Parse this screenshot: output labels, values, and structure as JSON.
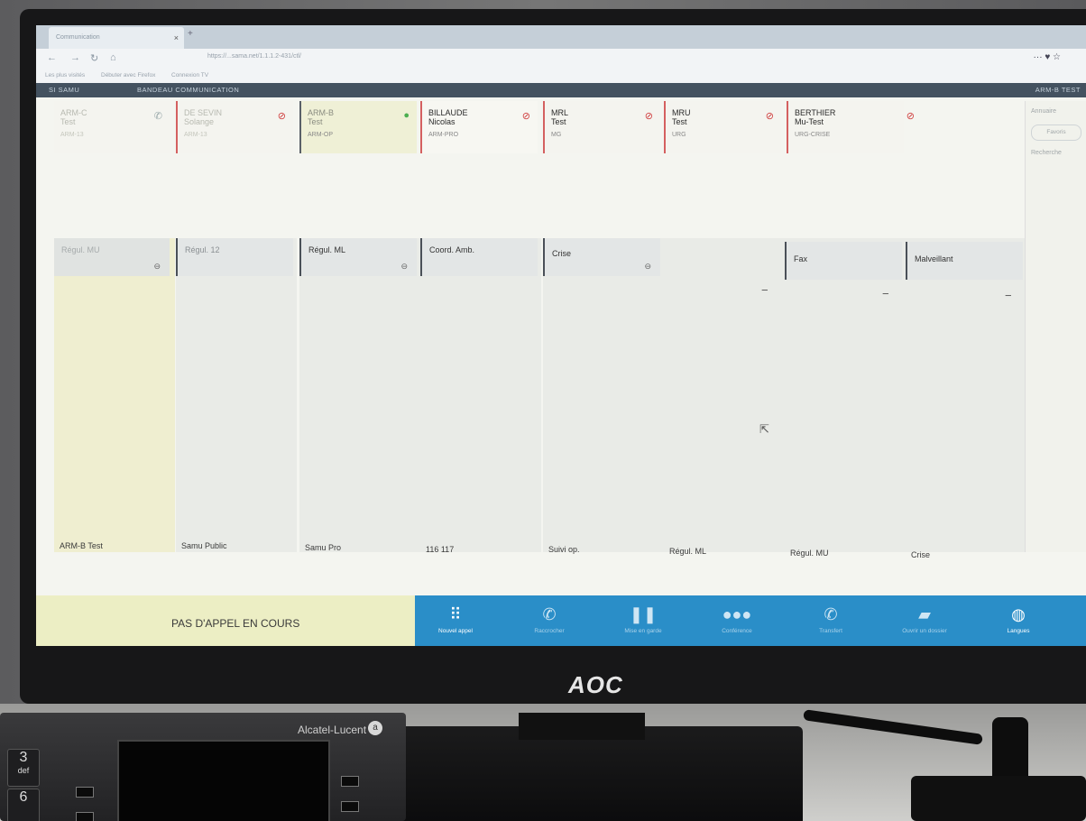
{
  "browser": {
    "tab_title": "Communication",
    "url": "https://...sama.net/1.1.1.2-431/ctl/",
    "bookmarks": [
      "Les plus visités",
      "Débuter avec Firefox",
      "Connexion TV"
    ],
    "nav_right": "··· ♥ ☆"
  },
  "app": {
    "title": "SI SAMU",
    "section": "BANDEAU COMMUNICATION",
    "user": "ARM-B TEST"
  },
  "contacts": [
    {
      "line1": "ARM-C",
      "line2": "Test",
      "role": "ARM-13",
      "status_icon": "phone-icon",
      "status_color": "#9aa",
      "faded": true
    },
    {
      "line1": "DE SEVIN",
      "line2": "Solange",
      "role": "ARM-13",
      "status_icon": "blocked-icon",
      "status_color": "#d04040",
      "faded": true
    },
    {
      "line1": "ARM-B",
      "line2": "Test",
      "role": "ARM-OP",
      "status_icon": "available-dot-icon",
      "status_color": "#4caf50",
      "faded": true
    },
    {
      "line1": "BILLAUDE",
      "line2": "Nicolas",
      "role": "ARM-PRO",
      "status_icon": "blocked-icon",
      "status_color": "#d04040",
      "faded": false
    },
    {
      "line1": "MRL",
      "line2": "Test",
      "role": "MG",
      "status_icon": "blocked-icon",
      "status_color": "#d04040",
      "faded": false
    },
    {
      "line1": "MRU",
      "line2": "Test",
      "role": "URG",
      "status_icon": "blocked-icon",
      "status_color": "#d04040",
      "faded": false
    },
    {
      "line1": "BERTHIER",
      "line2": "Mu-Test",
      "role": "URG-CRISE",
      "status_icon": "blocked-icon",
      "status_color": "#d04040",
      "faded": false
    }
  ],
  "queues": [
    {
      "label": "Régul. MU",
      "footer": "ARM-B Test"
    },
    {
      "label": "Régul. 12",
      "footer": "Samu Public"
    },
    {
      "label": "Régul. ML",
      "footer": "Samu Pro"
    },
    {
      "label": "Coord. Amb.",
      "footer": "116 117"
    },
    {
      "label": "Crise",
      "footer": "Suivi op."
    },
    {
      "label": "",
      "footer": "Régul. ML"
    },
    {
      "label": "Fax",
      "footer": "Régul. MU"
    },
    {
      "label": "Malveillant",
      "footer": "Crise"
    }
  ],
  "right_panel": {
    "item1": "Annuaire",
    "item2": "Favoris",
    "item3": "Recherche"
  },
  "status": {
    "no_call": "PAS D'APPEL EN COURS"
  },
  "toolbar": [
    {
      "label": "Nouvel appel",
      "icon": "dialpad-icon",
      "active": true
    },
    {
      "label": "Raccrocher",
      "icon": "hangup-icon",
      "active": false
    },
    {
      "label": "Mise en garde",
      "icon": "pause-icon",
      "active": false
    },
    {
      "label": "Conférence",
      "icon": "group-icon",
      "active": false
    },
    {
      "label": "Transfert",
      "icon": "transfer-icon",
      "active": false
    },
    {
      "label": "Ouvrir un dossier",
      "icon": "folder-icon",
      "active": false
    },
    {
      "label": "Langues",
      "icon": "globe-icon",
      "active": true
    }
  ],
  "monitor": {
    "brand": "AOC"
  },
  "phone": {
    "brand": "Alcatel-Lucent",
    "keys": [
      {
        "num": "3",
        "sub": "def"
      },
      {
        "num": "6",
        "sub": ""
      }
    ]
  }
}
